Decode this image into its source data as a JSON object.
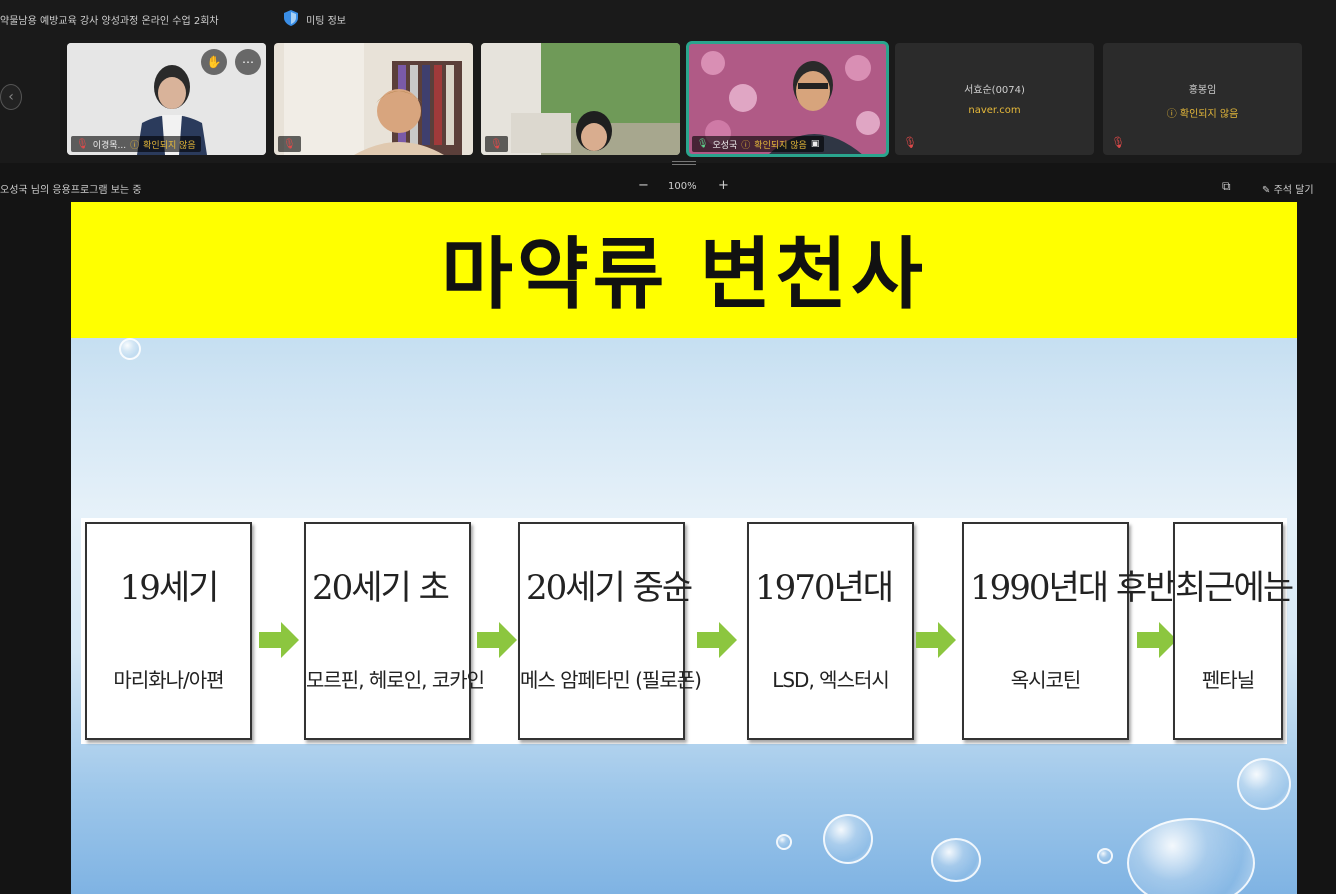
{
  "window": {
    "title": "약물남용 예방교육 강사 양성과정 온라인 수업 2회차",
    "meeting_info_label": "미팅 정보"
  },
  "gallery": {
    "participants": [
      {
        "name": "이경목...",
        "status": "확인되지 않음"
      },
      {
        "name": "",
        "status": ""
      },
      {
        "name": "",
        "status": ""
      },
      {
        "name": "오성국",
        "status": "확인되지 않음"
      },
      {
        "name": "서효순(0074)",
        "sub": "naver.com"
      },
      {
        "name": "홍봉임",
        "status": "확인되지 않음"
      }
    ]
  },
  "sharebar": {
    "viewing_text": "오성국 님의 응용프로그램 보는 중",
    "zoom_level": "100%",
    "zoom_minus": "−",
    "zoom_plus": "+",
    "annotate_label": "주석 달기"
  },
  "slide": {
    "title": "마약류 변천사",
    "timeline": [
      {
        "era": "19세기",
        "drugs": "마리화나/아편"
      },
      {
        "era": "20세기 초",
        "drugs": "모르핀, 헤로인, 코카인"
      },
      {
        "era": "20세기 중순",
        "drugs": "메스 암페타민 (필로폰)"
      },
      {
        "era": "1970년대",
        "drugs": "LSD, 엑스터시"
      },
      {
        "era": "1990년대 후반",
        "drugs": "옥시코틴"
      },
      {
        "era": "최근에는",
        "drugs": "펜타닐"
      }
    ]
  },
  "colors": {
    "slide_header": "#ffff00",
    "arrow": "#8cc63f",
    "active_tile": "#2aa58e",
    "warning": "#e6b93a"
  }
}
